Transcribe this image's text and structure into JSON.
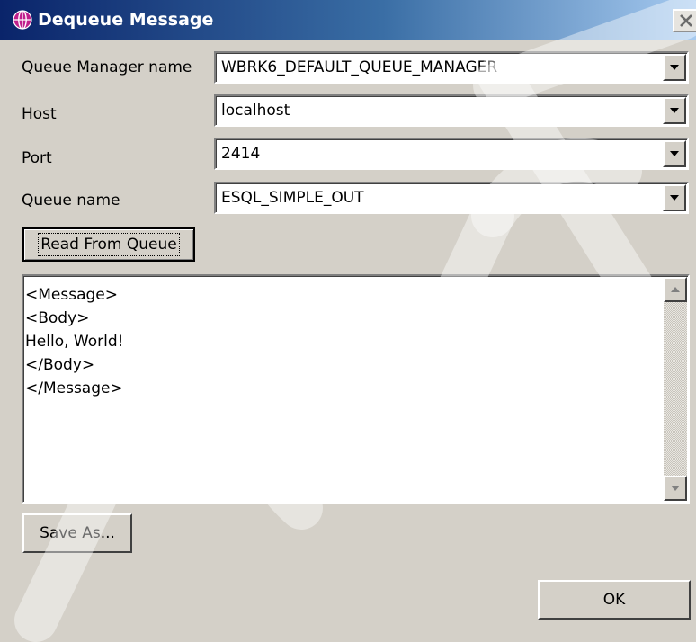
{
  "window": {
    "title": "Dequeue Message",
    "close_label": "X"
  },
  "form": {
    "queue_manager": {
      "label": "Queue Manager name",
      "value": "WBRK6_DEFAULT_QUEUE_MANAGER"
    },
    "host": {
      "label": "Host",
      "value": "localhost"
    },
    "port": {
      "label": "Port",
      "value": "2414"
    },
    "queue_name": {
      "label": "Queue name",
      "value": "ESQL_SIMPLE_OUT"
    }
  },
  "buttons": {
    "read_label": "Read From Queue",
    "save_label": "Save As...",
    "ok_label": "OK"
  },
  "message_text": {
    "lines": [
      "<Message>",
      "<Body>",
      "Hello, World!",
      "</Body>",
      "</Message>"
    ]
  },
  "icons": {
    "title": "websphere-globe-icon",
    "close": "close-icon",
    "dropdown": "chevron-down-icon",
    "scroll_up": "arrow-up-icon",
    "scroll_down": "arrow-down-icon"
  },
  "colors": {
    "titlebar_start": "#0a246a",
    "titlebar_end": "#a6caf0",
    "dialog_background": "#d4d0c8",
    "title_icon": "#c0208c"
  }
}
